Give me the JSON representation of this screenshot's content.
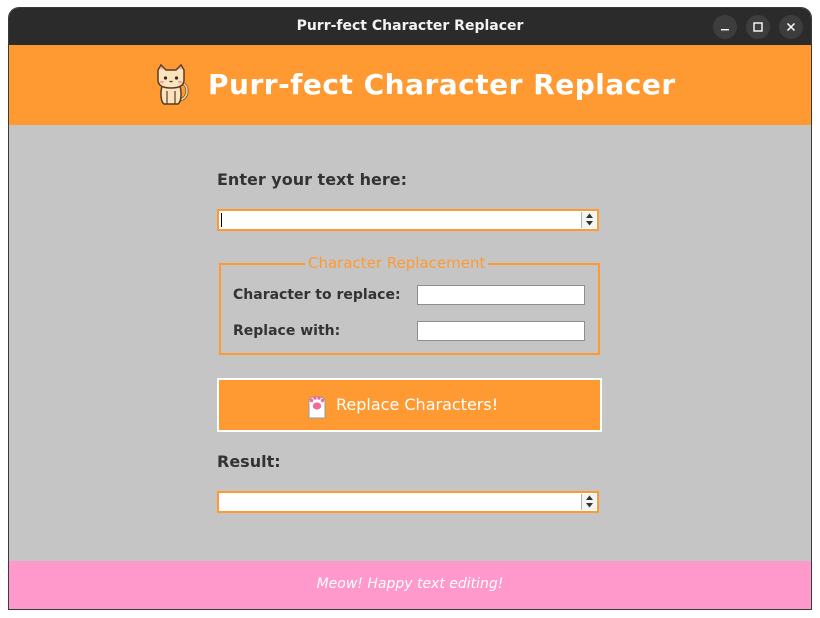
{
  "window": {
    "title": "Purr-fect Character Replacer",
    "controls": [
      "minimize-icon",
      "maximize-icon",
      "close-icon"
    ]
  },
  "header": {
    "icon": "cat-icon",
    "title": "Purr-fect Character Replacer",
    "background": "#ff9a33"
  },
  "input_section": {
    "label": "Enter your text here:",
    "value": ""
  },
  "replacement": {
    "legend": "Character Replacement",
    "char_label": "Character to replace:",
    "char_value": "",
    "with_label": "Replace with:",
    "with_value": ""
  },
  "action": {
    "icon": "paw-icon",
    "label": "Replace Characters!"
  },
  "result": {
    "label": "Result:",
    "value": ""
  },
  "footer": {
    "text": "Meow! Happy text editing!",
    "background": "#ff99cc"
  },
  "colors": {
    "accent": "#ff9a33",
    "body": "#c5c5c5",
    "footer": "#ff99cc",
    "titlebar": "#2b2b2b"
  }
}
